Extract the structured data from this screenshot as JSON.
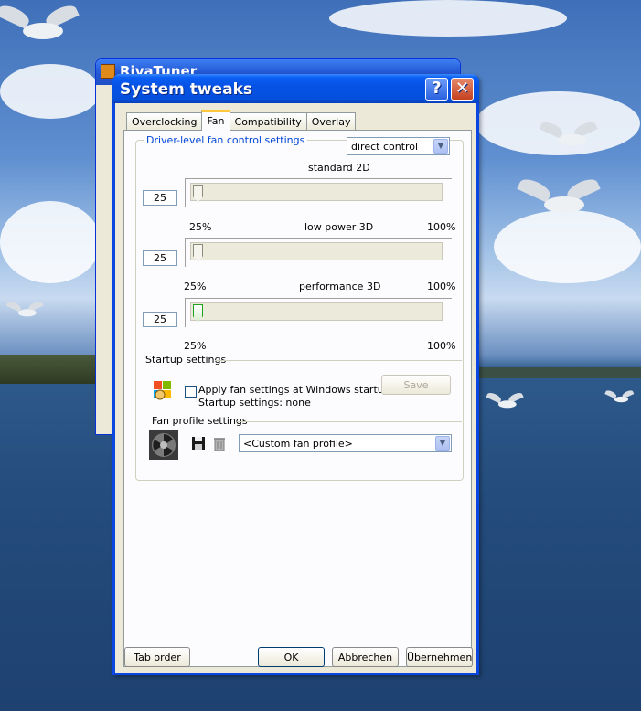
{
  "background_window": {
    "title": "RivaTuner"
  },
  "window": {
    "title": "System tweaks",
    "help_icon": "?",
    "close_icon": "✕"
  },
  "tabs": [
    {
      "label": "Overclocking",
      "active": false
    },
    {
      "label": "Fan",
      "active": true
    },
    {
      "label": "Compatibility",
      "active": false
    },
    {
      "label": "Overlay",
      "active": false
    }
  ],
  "fan_control": {
    "group_label": "Driver-level fan control settings",
    "mode_value": "direct control",
    "sliders": [
      {
        "label": "standard 2D",
        "value": "25",
        "min_label": "25%",
        "max_label": "100%",
        "level_percent": 25
      },
      {
        "label": "low power 3D",
        "value": "25",
        "min_label": "25%",
        "max_label": "100%",
        "level_percent": 25
      },
      {
        "label": "performance 3D",
        "value": "25",
        "min_label": "25%",
        "max_label": "100%",
        "level_percent": 25
      }
    ]
  },
  "startup": {
    "section_label": "Startup settings",
    "checkbox_label": "Apply fan settings at Windows startup",
    "checked": false,
    "status_text": "Startup settings:  none",
    "save_label": "Save"
  },
  "profiles": {
    "section_label": "Fan profile settings",
    "selected_profile": "<Custom fan profile>"
  },
  "footer": {
    "tab_order_label": "Tab order",
    "ok_label": "OK",
    "cancel_label": "Abbrechen",
    "apply_label": "Übernehmen"
  },
  "colors": {
    "title_blue": "#0450dc",
    "group_label_blue": "#0046d5",
    "tab_highlight": "#ffc83c"
  }
}
